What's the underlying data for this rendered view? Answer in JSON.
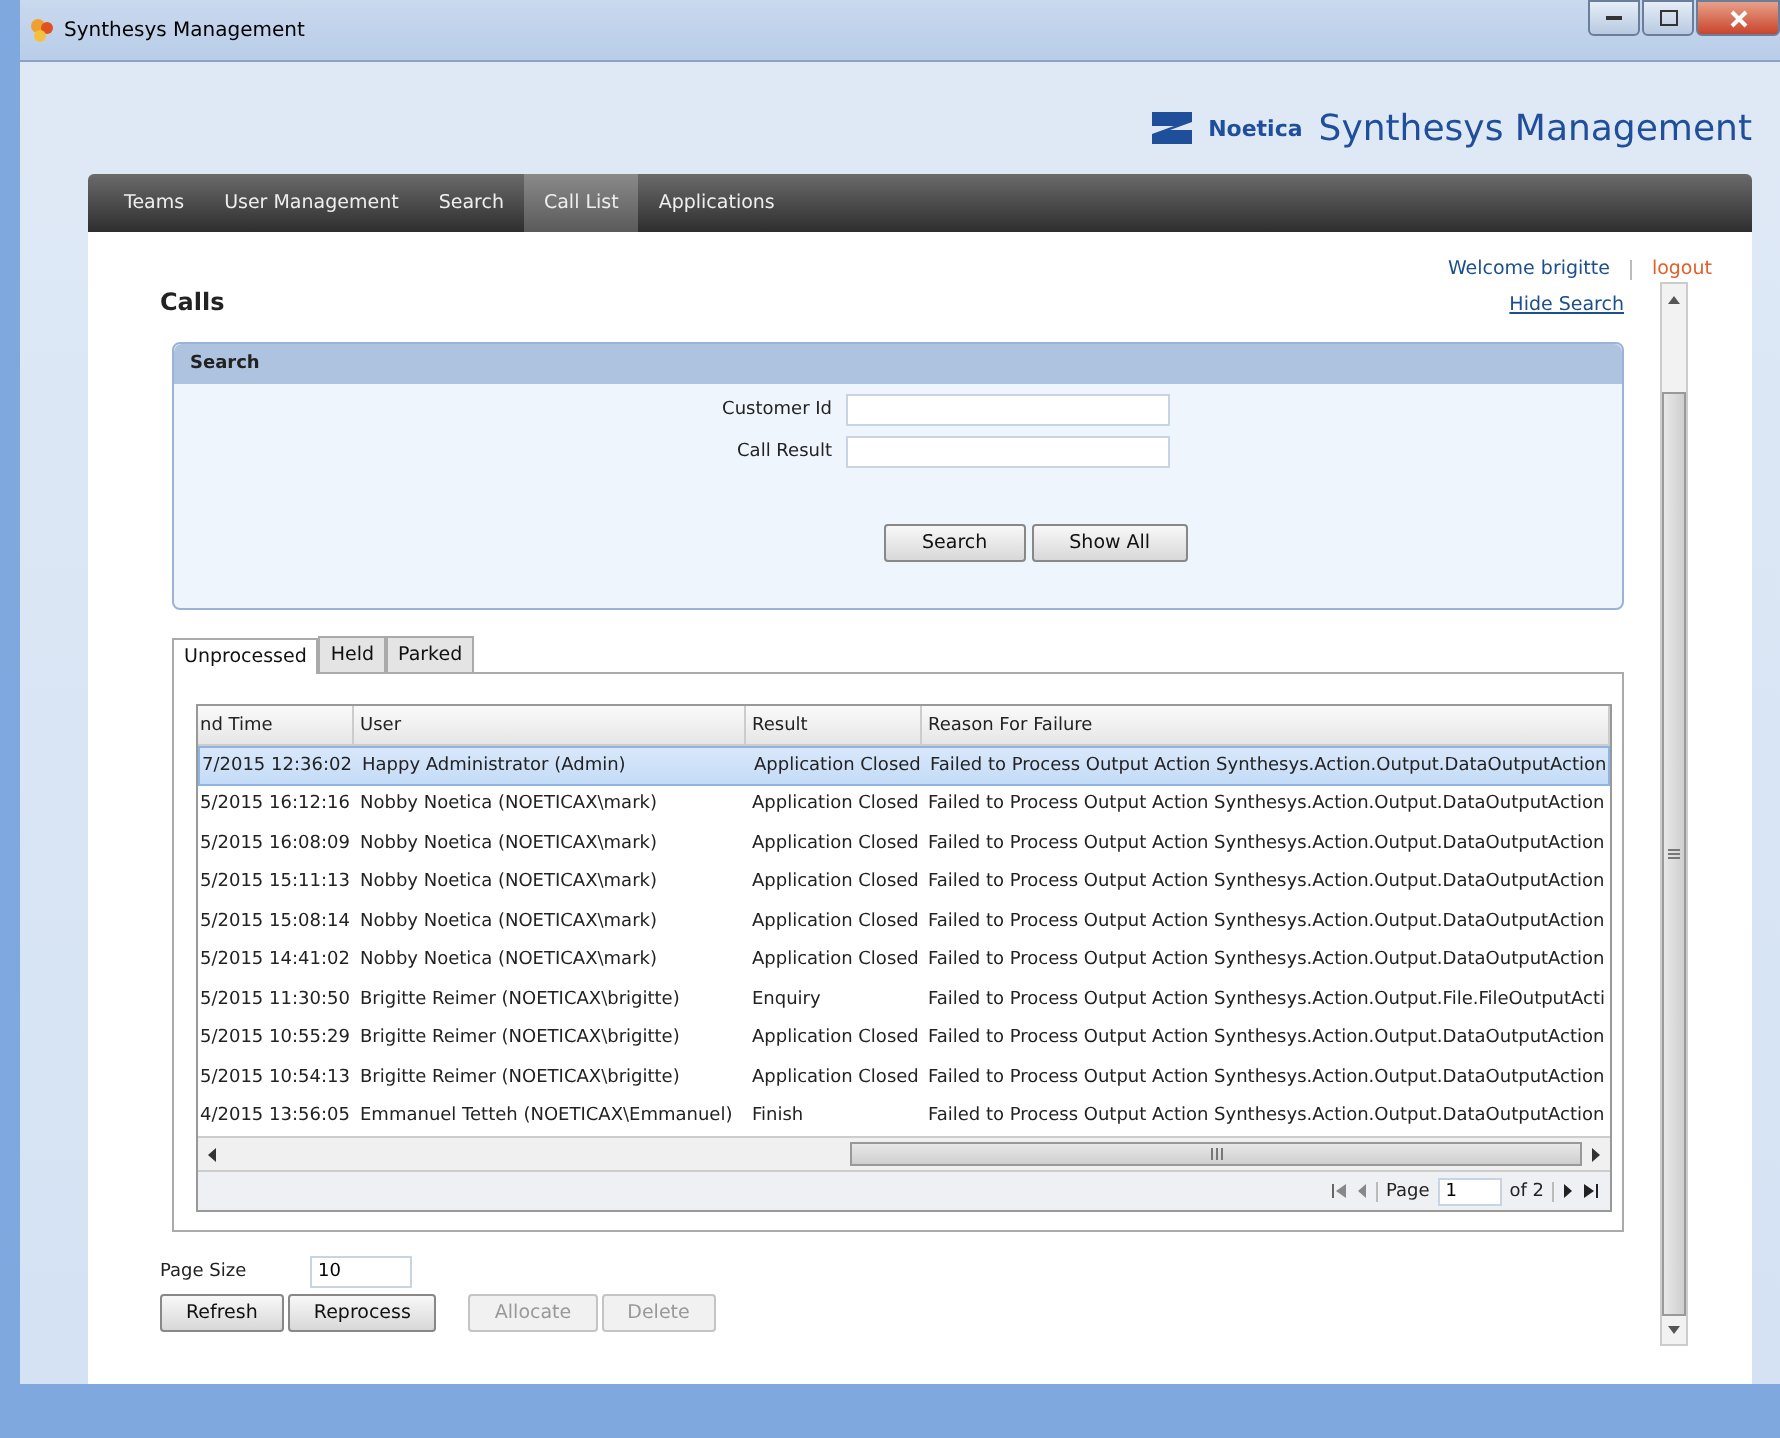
{
  "window": {
    "title": "Synthesys Management"
  },
  "brand": {
    "logo": "Noetica",
    "title": "Synthesys Management"
  },
  "nav": [
    {
      "label": "Teams",
      "selected": false
    },
    {
      "label": "User Management",
      "selected": false
    },
    {
      "label": "Search",
      "selected": false
    },
    {
      "label": "Call List",
      "selected": true
    },
    {
      "label": "Applications",
      "selected": false
    }
  ],
  "user": {
    "welcome": "Welcome brigitte",
    "logout": "logout"
  },
  "page_title": "Calls",
  "hide_search": "Hide Search",
  "search_panel": {
    "title": "Search",
    "fields": [
      {
        "label": "Customer Id"
      },
      {
        "label": "Call Result"
      }
    ],
    "buttons": [
      "Search",
      "Show All"
    ]
  },
  "tabs": [
    {
      "label": "Unprocessed",
      "selected": true
    },
    {
      "label": "Held",
      "selected": false
    },
    {
      "label": "Parked",
      "selected": false
    }
  ],
  "table": {
    "columns": [
      "nd Time",
      "User",
      "Result",
      "Reason For Failure"
    ],
    "rows": [
      {
        "selected": true,
        "cells": [
          "7/2015 12:36:02",
          "Happy Administrator (Admin)",
          "Application Closed",
          "Failed to Process Output Action Synthesys.Action.Output.DataOutputAction"
        ]
      },
      {
        "selected": false,
        "cells": [
          "5/2015 16:12:16",
          "Nobby Noetica (NOETICAX\\mark)",
          "Application Closed",
          "Failed to Process Output Action Synthesys.Action.Output.DataOutputAction"
        ]
      },
      {
        "selected": false,
        "cells": [
          "5/2015 16:08:09",
          "Nobby Noetica (NOETICAX\\mark)",
          "Application Closed",
          "Failed to Process Output Action Synthesys.Action.Output.DataOutputAction"
        ]
      },
      {
        "selected": false,
        "cells": [
          "5/2015 15:11:13",
          "Nobby Noetica (NOETICAX\\mark)",
          "Application Closed",
          "Failed to Process Output Action Synthesys.Action.Output.DataOutputAction"
        ]
      },
      {
        "selected": false,
        "cells": [
          "5/2015 15:08:14",
          "Nobby Noetica (NOETICAX\\mark)",
          "Application Closed",
          "Failed to Process Output Action Synthesys.Action.Output.DataOutputAction"
        ]
      },
      {
        "selected": false,
        "cells": [
          "5/2015 14:41:02",
          "Nobby Noetica (NOETICAX\\mark)",
          "Application Closed",
          "Failed to Process Output Action Synthesys.Action.Output.DataOutputAction"
        ]
      },
      {
        "selected": false,
        "cells": [
          "5/2015 11:30:50",
          "Brigitte Reimer (NOETICAX\\brigitte)",
          "Enquiry",
          "Failed to Process Output Action Synthesys.Action.Output.File.FileOutputActi"
        ]
      },
      {
        "selected": false,
        "cells": [
          "5/2015 10:55:29",
          "Brigitte Reimer (NOETICAX\\brigitte)",
          "Application Closed",
          "Failed to Process Output Action Synthesys.Action.Output.DataOutputAction"
        ]
      },
      {
        "selected": false,
        "cells": [
          "5/2015 10:54:13",
          "Brigitte Reimer (NOETICAX\\brigitte)",
          "Application Closed",
          "Failed to Process Output Action Synthesys.Action.Output.DataOutputAction"
        ]
      },
      {
        "selected": false,
        "cells": [
          "4/2015 13:56:05",
          "Emmanuel Tetteh (NOETICAX\\Emmanuel)",
          "Finish",
          "Failed to Process Output Action Synthesys.Action.Output.DataOutputAction"
        ]
      }
    ]
  },
  "pager": {
    "page_label": "Page",
    "page": "1",
    "of": "of 2"
  },
  "page_size": {
    "label": "Page Size",
    "value": "10"
  },
  "actions": [
    {
      "label": "Refresh",
      "disabled": false
    },
    {
      "label": "Reprocess",
      "disabled": false
    },
    {
      "label": "Allocate",
      "disabled": true
    },
    {
      "label": "Delete",
      "disabled": true
    }
  ]
}
